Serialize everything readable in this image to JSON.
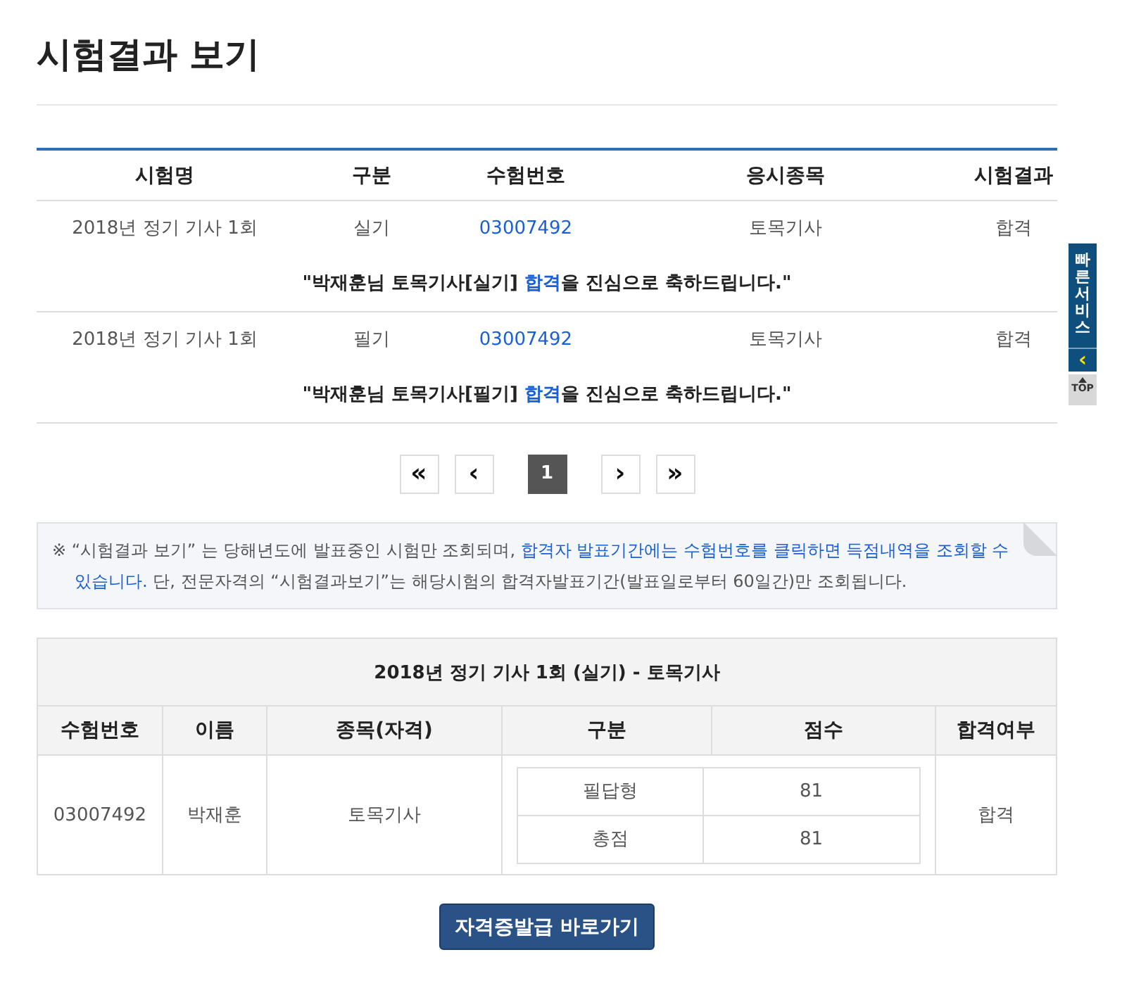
{
  "page_title": "시험결과 보기",
  "results_table": {
    "columns": [
      "시험명",
      "구분",
      "수험번호",
      "응시종목",
      "시험결과"
    ],
    "rows": [
      {
        "exam": "2018년 정기 기사 1회",
        "type": "실기",
        "number": "03007492",
        "subject": "토목기사",
        "result": "합격",
        "message": {
          "before": "\"박재훈님 토목기사[실기] ",
          "highlight": "합격",
          "after": "을 진심으로 축하드립니다.\""
        }
      },
      {
        "exam": "2018년 정기 기사 1회",
        "type": "필기",
        "number": "03007492",
        "subject": "토목기사",
        "result": "합격",
        "message": {
          "before": "\"박재훈님 토목기사[필기] ",
          "highlight": "합격",
          "after": "을 진심으로 축하드립니다.\""
        }
      }
    ]
  },
  "pagination": {
    "first": "«",
    "prev": "‹",
    "pages": [
      {
        "label": "1",
        "selected": true
      }
    ],
    "next": "›",
    "last": "»"
  },
  "notice": {
    "before": "※ “시험결과 보기” 는 당해년도에 발표중인 시험만 조회되며, ",
    "highlight": "합격자 발표기간에는 수험번호를 클릭하면 득점내역을 조회할 수 있습니다.",
    "after": " 단, 전문자격의 “시험결과보기”는 해당시험의 합격자발표기간(발표일로부터 60일간)만 조회됩니다."
  },
  "detail": {
    "title": "2018년 정기 기사 1회 (실기) - 토목기사",
    "columns": [
      "수험번호",
      "이름",
      "종목(자격)",
      "구분",
      "점수",
      "합격여부"
    ],
    "number": "03007492",
    "name": "박재훈",
    "subject": "토목기사",
    "scores": [
      {
        "label": "필답형",
        "score": "81"
      },
      {
        "label": "총점",
        "score": "81"
      }
    ],
    "result": "합격"
  },
  "button": "자격증발급 바로가기",
  "quick_menu": {
    "title": "빠른서비스",
    "collapse": "‹",
    "top": "TOP"
  }
}
